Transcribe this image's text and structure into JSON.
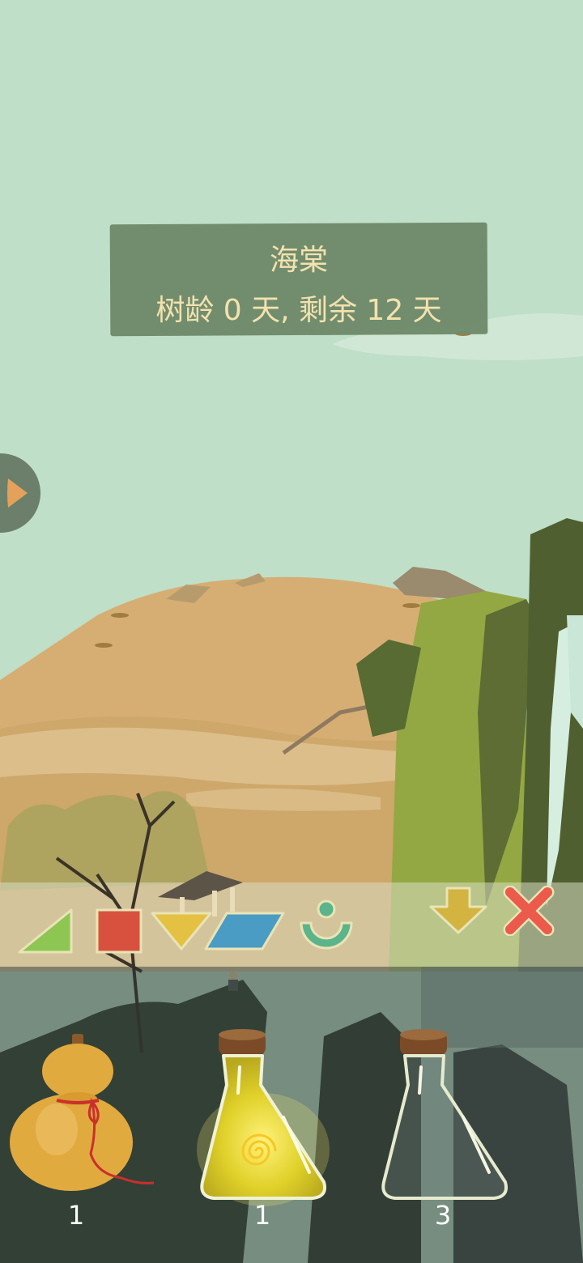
{
  "banner": {
    "plant_name": "海棠",
    "age_text": "树龄 0 天, 剩余 12 天"
  },
  "side_tab": {
    "icon": "play-arrow-icon"
  },
  "toolbar": {
    "shapes": [
      {
        "name": "triangle-icon",
        "color": "#8dc653"
      },
      {
        "name": "square-icon",
        "color": "#d8513e"
      },
      {
        "name": "inverted-triangle-icon",
        "color": "#e5c143"
      },
      {
        "name": "parallelogram-icon",
        "color": "#4a9cc4"
      },
      {
        "name": "cup-icon",
        "color": "#5bb48a"
      }
    ],
    "actions": [
      {
        "name": "down-arrow-icon",
        "color": "#d3b440"
      },
      {
        "name": "close-icon",
        "color": "#ec5a4b"
      }
    ]
  },
  "inventory": {
    "items": [
      {
        "name": "gourd",
        "count": "1"
      },
      {
        "name": "glowing-potion-flask",
        "count": "1"
      },
      {
        "name": "empty-flask",
        "count": "3"
      }
    ]
  }
}
